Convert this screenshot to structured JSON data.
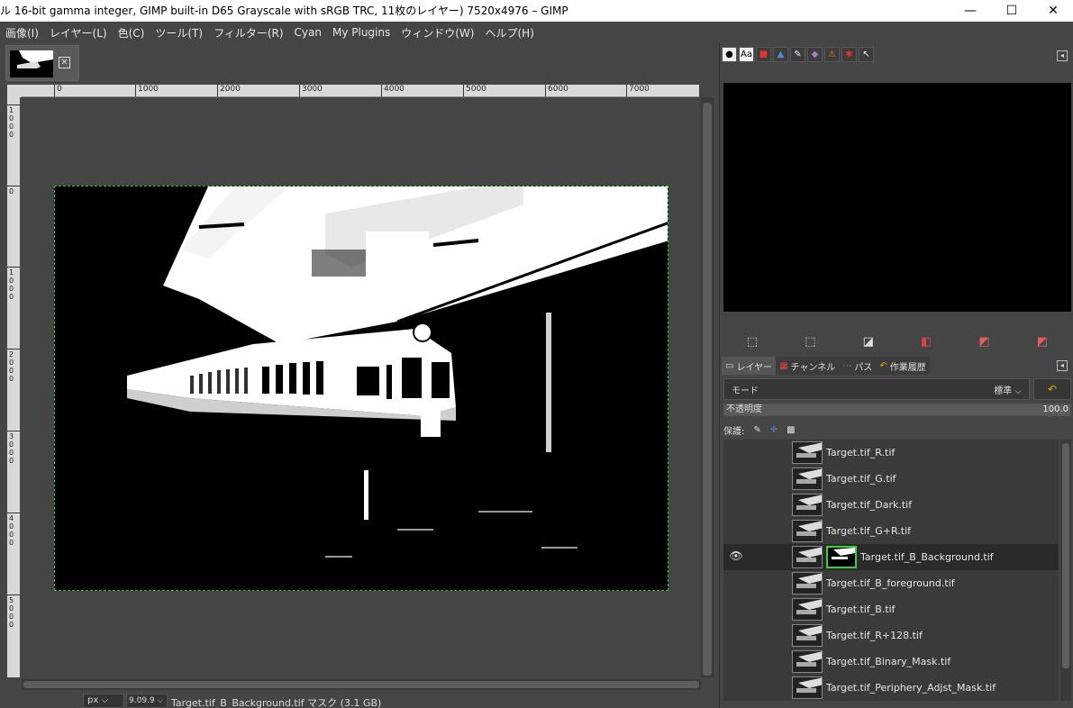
{
  "window": {
    "title": "ル 16-bit gamma integer, GIMP built-in D65 Grayscale with sRGB TRC, 11枚のレイヤー) 7520x4976 – GIMP",
    "minimize": "—",
    "maximize": "☐",
    "close": "✕"
  },
  "menu": [
    "画像(I)",
    "レイヤー(L)",
    "色(C)",
    "ツール(T)",
    "フィルター(R)",
    "Cyan",
    "My Plugins",
    "ウィンドウ(W)",
    "ヘルプ(H)"
  ],
  "ruler": {
    "h_labels": [
      "0",
      "1000",
      "2000",
      "3000",
      "4000",
      "5000",
      "6000",
      "7000"
    ],
    "v_labels": [
      "1000",
      "0",
      "1000",
      "2000",
      "3000",
      "4000",
      "5000"
    ]
  },
  "statusbar": {
    "unit": "px",
    "zoom": "9.09.9",
    "message": "Target.tif_B_Background.tif マスク (3.1 GB)"
  },
  "dock": {
    "top_tab_icons": [
      "●",
      "Aa",
      "■",
      "▲",
      "✎",
      "◆",
      "⚠",
      "✱",
      "↖"
    ],
    "tool_icons": [
      "⬚",
      "⬚",
      "◪",
      "◧",
      "◩",
      "◩"
    ],
    "tabs": [
      {
        "icon": "▭",
        "label": "レイヤー"
      },
      {
        "icon": "▦",
        "label": "チャンネル"
      },
      {
        "icon": "⋯",
        "label": "パス"
      },
      {
        "icon": "↶",
        "label": "作業履歴"
      }
    ],
    "mode_label": "モード",
    "mode_value": "標準",
    "opacity_label": "不透明度",
    "opacity_value": "100.0",
    "lock_label": "保護:",
    "lock_icons": [
      "✎",
      "✛",
      "▩"
    ]
  },
  "layers": [
    {
      "name": "Target.tif_R.tif",
      "visible": false,
      "active": false
    },
    {
      "name": "Target.tif_G.tif",
      "visible": false,
      "active": false
    },
    {
      "name": "Target.tif_Dark.tif",
      "visible": false,
      "active": false
    },
    {
      "name": "Target.tif_G+R.tif",
      "visible": false,
      "active": false
    },
    {
      "name": "Target.tif_B_Background.tif",
      "visible": true,
      "active": true
    },
    {
      "name": "Target.tif_B_foreground.tif",
      "visible": false,
      "active": false
    },
    {
      "name": "Target.tif_B.tif",
      "visible": false,
      "active": false
    },
    {
      "name": "Target.tif_R+128.tif",
      "visible": false,
      "active": false
    },
    {
      "name": "Target.tif_Binary_Mask.tif",
      "visible": false,
      "active": false
    },
    {
      "name": "Target.tif_Periphery_Adjst_Mask.tif",
      "visible": false,
      "active": false
    }
  ],
  "icons": {
    "eye": "👁",
    "tab_close": "✕",
    "chevron": "⌵",
    "dock_menu": "◂"
  },
  "colors": {
    "selection_border": "#39c339",
    "mask_border": "#3ad13a",
    "panel_bg": "#454545",
    "accent_orange": "#e9a800"
  }
}
